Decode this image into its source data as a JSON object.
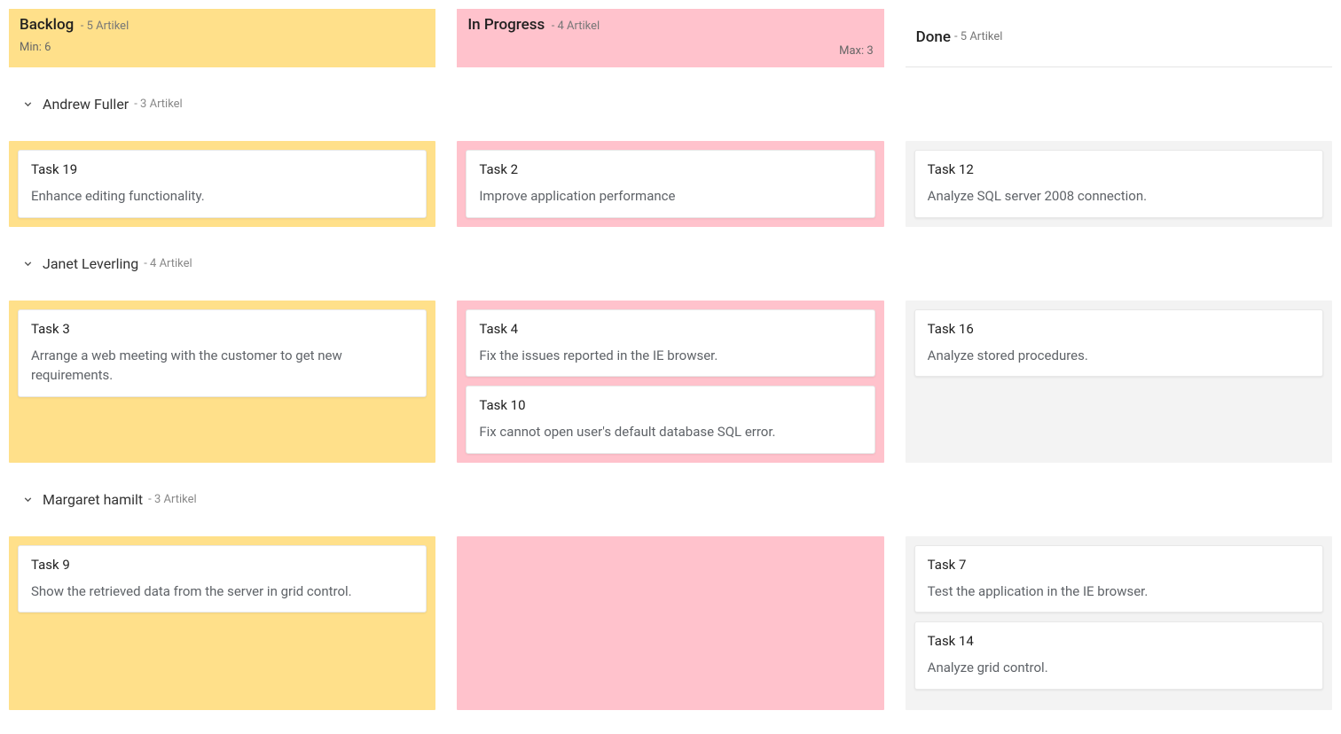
{
  "colors": {
    "backlog_bg": "#ffe08a",
    "inprogress_bg": "#ffc2cc",
    "done_bg": "#f3f3f3"
  },
  "columns": {
    "backlog": {
      "title": "Backlog",
      "sub": "- 5 Artikel",
      "limit_label": "Min: 6",
      "limit_side": "left"
    },
    "inprogress": {
      "title": "In Progress",
      "sub": "- 4 Artikel",
      "limit_label": "Max: 3",
      "limit_side": "right"
    },
    "done": {
      "title": "Done",
      "sub": "- 5 Artikel",
      "limit_label": "",
      "limit_side": ""
    }
  },
  "swimlanes": [
    {
      "name": "Andrew Fuller",
      "sub": "- 3 Artikel",
      "cells": {
        "backlog": [
          {
            "title": "Task 19",
            "desc": "Enhance editing functionality."
          }
        ],
        "inprogress": [
          {
            "title": "Task 2",
            "desc": "Improve application performance"
          }
        ],
        "done": [
          {
            "title": "Task 12",
            "desc": "Analyze SQL server 2008 connection."
          }
        ]
      }
    },
    {
      "name": "Janet Leverling",
      "sub": "- 4 Artikel",
      "cells": {
        "backlog": [
          {
            "title": "Task 3",
            "desc": "Arrange a web meeting with the customer to get new requirements."
          }
        ],
        "inprogress": [
          {
            "title": "Task 4",
            "desc": "Fix the issues reported in the IE browser."
          },
          {
            "title": "Task 10",
            "desc": "Fix cannot open user's default database SQL error."
          }
        ],
        "done": [
          {
            "title": "Task 16",
            "desc": "Analyze stored procedures."
          }
        ]
      }
    },
    {
      "name": "Margaret hamilt",
      "sub": "- 3 Artikel",
      "cells": {
        "backlog": [
          {
            "title": "Task 9",
            "desc": "Show the retrieved data from the server in grid control."
          }
        ],
        "inprogress": [],
        "done": [
          {
            "title": "Task 7",
            "desc": "Test the application in the IE browser."
          },
          {
            "title": "Task 14",
            "desc": "Analyze grid control."
          }
        ]
      },
      "min_cell_height": 196
    }
  ]
}
